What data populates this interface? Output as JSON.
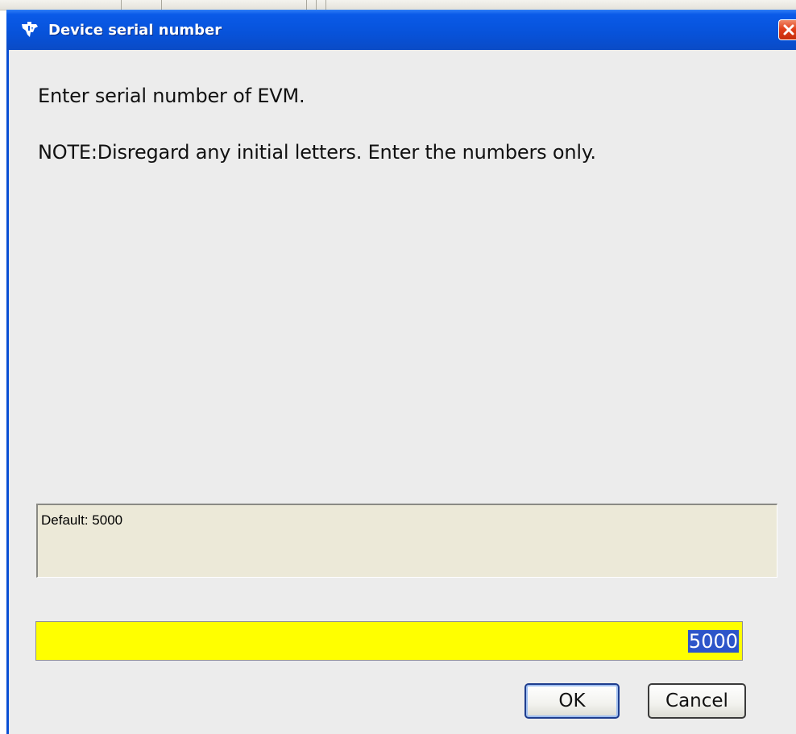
{
  "dialog": {
    "title": "Device serial number",
    "title_icon": "ti-logo-icon",
    "close_icon": "close-icon",
    "message_line1": "Enter serial number of EVM.",
    "message_line2": "NOTE:Disregard any initial letters.  Enter the numbers only.",
    "default_text": "Default: 5000",
    "serial_input_value": "5000",
    "serial_input_bg": "#ffff00",
    "ok_label": "OK",
    "cancel_label": "Cancel"
  },
  "colors": {
    "titlebar": "#0752d9",
    "client_bg": "#ececec",
    "close_button": "#e2401c",
    "selection": "#2d55c9"
  }
}
